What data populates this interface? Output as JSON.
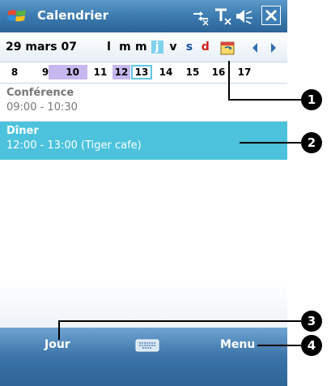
{
  "titlebar": {
    "title": "Calendrier",
    "icons": [
      "windows-start-icon",
      "connectivity-icon",
      "signal-off-icon",
      "volume-icon",
      "close-icon"
    ]
  },
  "navbar": {
    "date": "29 mars 07",
    "days": [
      "l",
      "m",
      "m",
      "j",
      "v",
      "s",
      "d"
    ],
    "today_index": 3
  },
  "dates": [
    "8",
    "9",
    "10",
    "11",
    "12",
    "13",
    "14",
    "15",
    "16",
    "17"
  ],
  "appointments": [
    {
      "title": "Conférence",
      "time": "09:00 - 10:30"
    },
    {
      "title": "Dîner",
      "time": "12:00 - 13:00 (Tiger cafe)"
    }
  ],
  "menubar": {
    "left": "Jour",
    "right": "Menu"
  },
  "callouts": [
    "1",
    "2",
    "3",
    "4"
  ],
  "colors": {
    "titlebar": "#3a78ad",
    "selected_appointment": "#4cc2dc",
    "week_highlight": "#c6b8ef",
    "today": "#7ed2ee"
  }
}
